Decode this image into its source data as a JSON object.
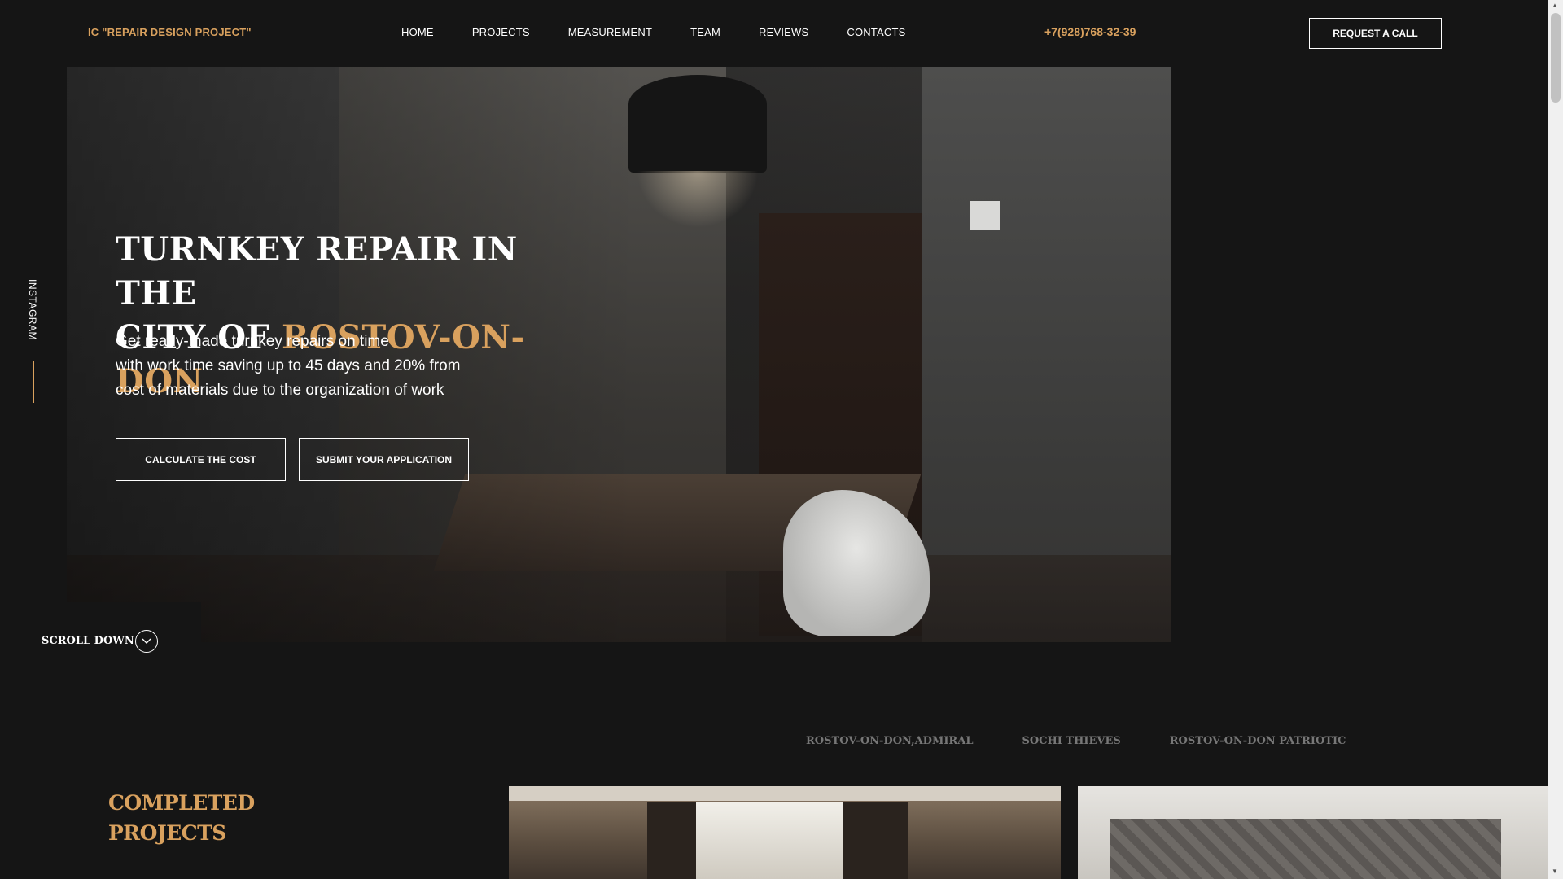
{
  "header": {
    "logo": "IC \"REPAIR DESIGN PROJECT\"",
    "nav": [
      "HOME",
      "PROJECTS",
      "MEASUREMENT",
      "TEAM",
      "REVIEWS",
      "CONTACTS"
    ],
    "phone": "+7(928)768-32-39",
    "request_label": "REQUEST A CALL"
  },
  "side": {
    "instagram": "INSTAGRAM"
  },
  "hero": {
    "title_line1": "TURNKEY REPAIR IN THE",
    "title_line2_prefix": "CITY OF ",
    "title_line2_accent": "ROSTOV-ON-DON",
    "text_line1": "Get ready-made turnkey repairs on time",
    "text_line2": "with work time saving up to 45 days and 20% from",
    "text_line3": "cost of materials due to the organization of work",
    "btn_calc": "CALCULATE THE COST",
    "btn_submit": "SUBMIT YOUR APPLICATION",
    "scroll_label": "SCROLL DOWN",
    "scroll_icon": "chevron-down-icon"
  },
  "projects": {
    "tabs": [
      "ROSTOV-ON-DON,ADMIRAL",
      "SOCHI THIEVES",
      "ROSTOV-ON-DON PATRIOTIC"
    ],
    "title_line1": "COMPLETED",
    "title_line2": "PROJECTS"
  },
  "colors": {
    "accent": "#d9a15e",
    "background": "#151515",
    "text": "#ffffff",
    "tab_inactive": "#777777"
  }
}
